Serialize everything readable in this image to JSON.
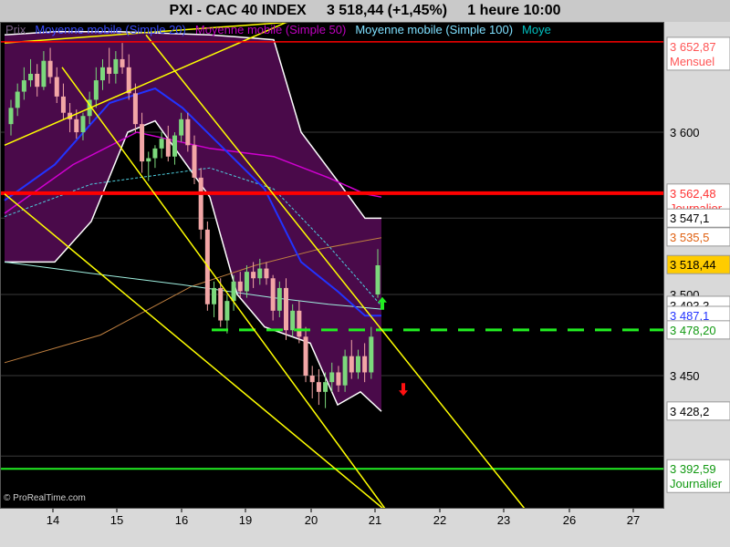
{
  "header": {
    "title_left": "PXI - CAC 40 INDEX",
    "title_price": "3 518,44 (+1,45%)",
    "title_period": "1 heure  10:00"
  },
  "legend": [
    {
      "label": "Prix",
      "color": "#7a5f86"
    },
    {
      "label": "Moyenne mobile (Simple 20)",
      "color": "#3a4cff"
    },
    {
      "label": "Moyenne mobile (Simple 50)",
      "color": "#c000c0"
    },
    {
      "label": "Moyenne mobile (Simple 100)",
      "color": "#7fe0ff"
    },
    {
      "label": "Moye",
      "color": "#00c0c0"
    }
  ],
  "credit": "© ProRealTime.com",
  "colors": {
    "background": "#000000",
    "bollinger_fill": "#4a0a4a",
    "bollinger_border": "#ffffff",
    "candle_up": "#7cd87c",
    "candle_down": "#f2a6a6",
    "resistance_red": "#ff0000",
    "support_green": "#22ee22",
    "channel_yellow": "#ffff00",
    "ma20": "#2233ff",
    "ma50": "#d000d0",
    "ma100": "#4fd0e0",
    "ma200": "#c08040"
  },
  "chart_data": {
    "type": "candlestick",
    "title": "PXI - CAC 40 INDEX",
    "x_tick_labels": [
      "14",
      "15",
      "16",
      "19",
      "20",
      "21",
      "22",
      "23",
      "26",
      "27"
    ],
    "y_ticks": [
      3450,
      3600
    ],
    "y_tick_labels": [
      "3 450",
      "3 600"
    ],
    "ylim": [
      3368,
      3668
    ],
    "y_axis_labels": [
      {
        "value": 3652.87,
        "text": "3 652,87",
        "sub": "Mensuel",
        "color": "#ff5555",
        "box": "#ffffff"
      },
      {
        "value": 3562.48,
        "text": "3 562,48",
        "sub": "Journalier",
        "color": "#ff3333",
        "box": "#ffffff"
      },
      {
        "value": 3547.1,
        "text": "3 547,1",
        "color": "#000000",
        "box": "#ffffff"
      },
      {
        "value": 3535.5,
        "text": "3 535,5",
        "color": "#e06010",
        "box": "#ffffff"
      },
      {
        "value": 3518.44,
        "text": "3 518,44",
        "color": "#000000",
        "box": "#ffcc00"
      },
      {
        "value": 3500,
        "text": "3 500",
        "color": "#000000",
        "box": "none"
      },
      {
        "value": 3493.3,
        "text": "3 493,3",
        "color": "#000000",
        "box": "#ffffff"
      },
      {
        "value": 3487.1,
        "text": "3 487,1",
        "color": "#2233ff",
        "box": "#ffffff"
      },
      {
        "value": 3478.2,
        "text": "3 478,20",
        "color": "#119911",
        "box": "#ffffff"
      },
      {
        "value": 3428.2,
        "text": "3 428,2",
        "color": "#000000",
        "box": "#ffffff"
      },
      {
        "value": 3392.59,
        "text": "3 392,59",
        "sub": "Journalier",
        "color": "#119911",
        "box": "#ffffff"
      }
    ],
    "candles": [
      [
        3605,
        3620,
        3598,
        3615
      ],
      [
        3615,
        3630,
        3610,
        3625
      ],
      [
        3625,
        3640,
        3620,
        3632
      ],
      [
        3632,
        3645,
        3628,
        3636
      ],
      [
        3636,
        3642,
        3622,
        3628
      ],
      [
        3628,
        3650,
        3626,
        3644
      ],
      [
        3644,
        3652,
        3630,
        3634
      ],
      [
        3634,
        3640,
        3618,
        3622
      ],
      [
        3622,
        3630,
        3608,
        3612
      ],
      [
        3612,
        3618,
        3600,
        3608
      ],
      [
        3608,
        3614,
        3596,
        3600
      ],
      [
        3600,
        3612,
        3595,
        3610
      ],
      [
        3610,
        3625,
        3605,
        3620
      ],
      [
        3620,
        3640,
        3615,
        3632
      ],
      [
        3632,
        3645,
        3626,
        3640
      ],
      [
        3640,
        3652,
        3630,
        3636
      ],
      [
        3636,
        3650,
        3630,
        3645
      ],
      [
        3645,
        3655,
        3636,
        3640
      ],
      [
        3640,
        3648,
        3620,
        3624
      ],
      [
        3624,
        3630,
        3600,
        3605
      ],
      [
        3605,
        3612,
        3575,
        3582
      ],
      [
        3582,
        3588,
        3570,
        3584
      ],
      [
        3584,
        3592,
        3578,
        3590
      ],
      [
        3590,
        3600,
        3584,
        3596
      ],
      [
        3596,
        3604,
        3582,
        3585
      ],
      [
        3585,
        3600,
        3580,
        3598
      ],
      [
        3598,
        3612,
        3594,
        3608
      ],
      [
        3608,
        3612,
        3588,
        3592
      ],
      [
        3592,
        3598,
        3568,
        3572
      ],
      [
        3572,
        3578,
        3534,
        3540
      ],
      [
        3540,
        3545,
        3490,
        3494
      ],
      [
        3494,
        3508,
        3486,
        3504
      ],
      [
        3504,
        3510,
        3480,
        3484
      ],
      [
        3484,
        3500,
        3476,
        3496
      ],
      [
        3496,
        3512,
        3490,
        3508
      ],
      [
        3508,
        3514,
        3498,
        3502
      ],
      [
        3502,
        3518,
        3498,
        3514
      ],
      [
        3514,
        3520,
        3504,
        3510
      ],
      [
        3510,
        3522,
        3506,
        3516
      ],
      [
        3516,
        3520,
        3506,
        3510
      ],
      [
        3510,
        3512,
        3484,
        3490
      ],
      [
        3490,
        3508,
        3486,
        3504
      ],
      [
        3504,
        3510,
        3472,
        3478
      ],
      [
        3478,
        3494,
        3474,
        3490
      ],
      [
        3490,
        3496,
        3470,
        3474
      ],
      [
        3474,
        3480,
        3446,
        3450
      ],
      [
        3450,
        3456,
        3436,
        3446
      ],
      [
        3446,
        3454,
        3432,
        3440
      ],
      [
        3440,
        3452,
        3430,
        3446
      ],
      [
        3446,
        3458,
        3440,
        3452
      ],
      [
        3452,
        3456,
        3440,
        3444
      ],
      [
        3444,
        3466,
        3440,
        3462
      ],
      [
        3462,
        3472,
        3448,
        3452
      ],
      [
        3452,
        3466,
        3448,
        3462
      ],
      [
        3462,
        3470,
        3446,
        3452
      ],
      [
        3452,
        3480,
        3448,
        3474
      ],
      [
        3500,
        3528,
        3498,
        3518
      ]
    ],
    "bollinger_upper": [
      [
        5,
        3660
      ],
      [
        60,
        3662
      ],
      [
        130,
        3662
      ],
      [
        230,
        3660
      ],
      [
        300,
        3657
      ],
      [
        330,
        3600
      ],
      [
        370,
        3570
      ],
      [
        400,
        3547
      ],
      [
        418,
        3547
      ]
    ],
    "bollinger_lower": [
      [
        5,
        3520
      ],
      [
        60,
        3520
      ],
      [
        100,
        3545
      ],
      [
        140,
        3600
      ],
      [
        170,
        3607
      ],
      [
        230,
        3560
      ],
      [
        260,
        3500
      ],
      [
        290,
        3480
      ],
      [
        340,
        3470
      ],
      [
        370,
        3432
      ],
      [
        395,
        3440
      ],
      [
        418,
        3428
      ]
    ],
    "ma20": [
      [
        5,
        3558
      ],
      [
        60,
        3580
      ],
      [
        120,
        3618
      ],
      [
        170,
        3627
      ],
      [
        200,
        3615
      ],
      [
        245,
        3590
      ],
      [
        290,
        3565
      ],
      [
        330,
        3520
      ],
      [
        370,
        3502
      ],
      [
        400,
        3487
      ],
      [
        418,
        3487
      ]
    ],
    "ma50": [
      [
        5,
        3550
      ],
      [
        80,
        3580
      ],
      [
        150,
        3600
      ],
      [
        230,
        3590
      ],
      [
        300,
        3585
      ],
      [
        360,
        3572
      ],
      [
        400,
        3562
      ],
      [
        418,
        3560
      ]
    ],
    "ma100": [
      [
        5,
        3548
      ],
      [
        100,
        3568
      ],
      [
        230,
        3578
      ],
      [
        300,
        3565
      ],
      [
        360,
        3530
      ],
      [
        418,
        3493
      ]
    ],
    "ma200": [
      [
        5,
        3458
      ],
      [
        110,
        3475
      ],
      [
        210,
        3505
      ],
      [
        280,
        3518
      ],
      [
        350,
        3528
      ],
      [
        418,
        3535
      ]
    ],
    "mavg_cyan": [
      [
        5,
        3520
      ],
      [
        100,
        3513
      ],
      [
        200,
        3506
      ],
      [
        300,
        3498
      ],
      [
        360,
        3494
      ],
      [
        418,
        3491
      ]
    ],
    "resistance_level": 3562.48,
    "support_levels": [
      3478.2,
      3392.59
    ],
    "channel_lines": [
      [
        [
          68,
          3640
        ],
        [
          422,
          3368
        ]
      ],
      [
        [
          5,
          3562
        ],
        [
          420,
          3368
        ]
      ],
      [
        [
          160,
          3660
        ],
        [
          575,
          3368
        ]
      ],
      [
        [
          5,
          3655
        ],
        [
          320,
          3668
        ]
      ],
      [
        [
          5,
          3592
        ],
        [
          315,
          3668
        ]
      ]
    ],
    "arrows": [
      {
        "direction": "up",
        "x": 419,
        "value": 3494,
        "color": "#22ee22"
      },
      {
        "direction": "down",
        "x": 442,
        "value": 3442,
        "color": "#ff1111"
      }
    ]
  }
}
